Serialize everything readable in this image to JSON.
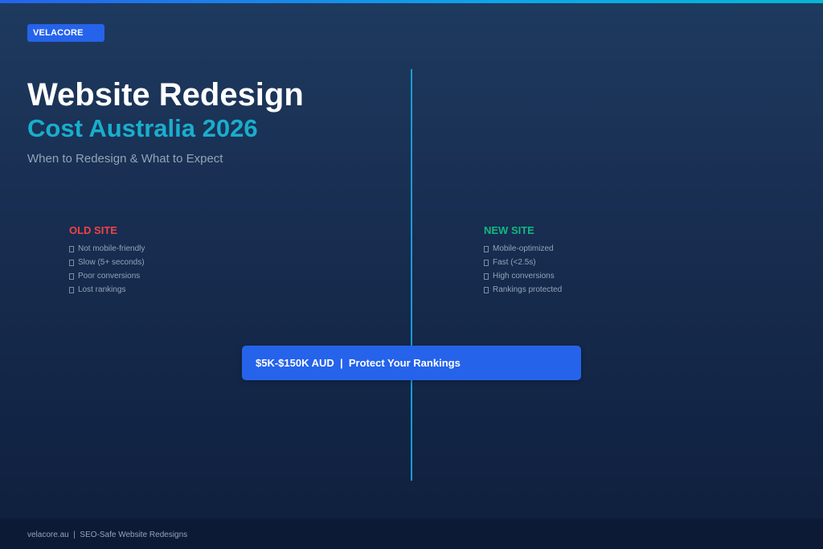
{
  "brand": {
    "badge_label": "VELACORE"
  },
  "hero": {
    "title_line_1": "Website Redesign",
    "title_line_2": "Cost Australia 2026",
    "subtitle": "When to Redesign & What to Expect"
  },
  "comparison": {
    "old": {
      "heading": "OLD SITE",
      "items": [
        "Not mobile-friendly",
        "Slow (5+ seconds)",
        "Poor conversions",
        "Lost rankings"
      ]
    },
    "new": {
      "heading": "NEW SITE",
      "items": [
        "Mobile-optimized",
        "Fast (<2.5s)",
        "High conversions",
        "Rankings protected"
      ]
    }
  },
  "cta": {
    "label": "$5K-$150K AUD  |  Protect Your Rankings"
  },
  "footer": {
    "text": "velacore.au  |  SEO-Safe Website Redesigns"
  },
  "colors": {
    "accent_blue": "#2563eb",
    "title_cyan": "#19aecd",
    "old_red": "#ef4444",
    "new_green": "#10b981",
    "muted_text": "#94a3b8",
    "divider": "#1b9bd1"
  },
  "icons": {
    "list_marker": "checkbox-placeholder-icon"
  }
}
